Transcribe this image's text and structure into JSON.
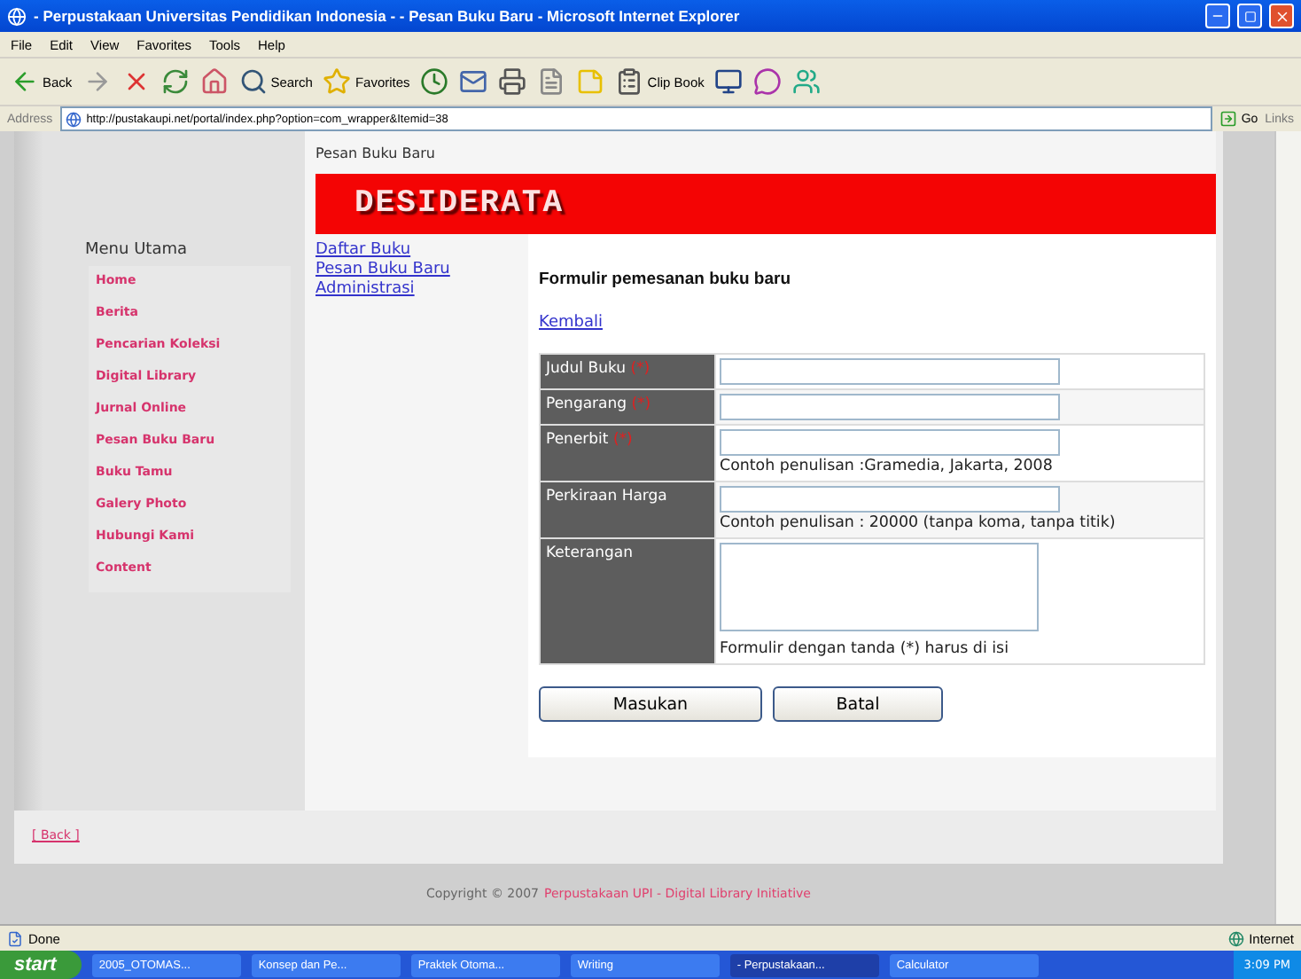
{
  "window": {
    "title": "- Perpustakaan Universitas Pendidikan Indonesia - - Pesan Buku Baru - Microsoft Internet Explorer"
  },
  "menu_bar": [
    "File",
    "Edit",
    "View",
    "Favorites",
    "Tools",
    "Help"
  ],
  "toolbar": [
    {
      "kind": "back",
      "label": "Back"
    },
    {
      "kind": "forward"
    },
    {
      "kind": "stop"
    },
    {
      "kind": "refresh"
    },
    {
      "kind": "home"
    },
    {
      "kind": "search",
      "label": "Search"
    },
    {
      "kind": "favorites",
      "label": "Favorites"
    },
    {
      "kind": "history"
    },
    {
      "kind": "mail"
    },
    {
      "kind": "print"
    },
    {
      "kind": "edit"
    },
    {
      "kind": "note"
    },
    {
      "kind": "clipbook",
      "label": "Clip Book"
    },
    {
      "kind": "screen"
    },
    {
      "kind": "messenger"
    },
    {
      "kind": "people"
    }
  ],
  "address_bar": {
    "label": "Address",
    "url": "http://pustakaupi.net/portal/index.php?option=com_wrapper&Itemid=38",
    "go": "Go",
    "links": "Links"
  },
  "page": {
    "breadcrumb": "Pesan Buku Baru",
    "banner": "DESIDERATA",
    "sidebar": {
      "title": "Menu Utama",
      "items": [
        "Home",
        "Berita",
        "Pencarian Koleksi",
        "Digital Library",
        "Jurnal Online",
        "Pesan Buku Baru",
        "Buku Tamu",
        "Galery Photo",
        "Hubungi Kami",
        "Content"
      ]
    },
    "sub_links": [
      "Daftar Buku",
      "Pesan Buku Baru",
      "Administrasi"
    ],
    "form": {
      "title": "Formulir pemesanan buku baru",
      "back_link": "Kembali",
      "fields": [
        {
          "kind": "input",
          "label": "Judul Buku",
          "marker": "(*)"
        },
        {
          "kind": "input",
          "label": "Pengarang",
          "marker": "(*)"
        },
        {
          "kind": "input",
          "label": "Penerbit",
          "marker": "(*)",
          "hint": "Contoh penulisan :Gramedia, Jakarta, 2008"
        },
        {
          "kind": "input",
          "label": "Perkiraan Harga",
          "hint": "Contoh penulisan : 20000 (tanpa koma, tanpa titik)"
        },
        {
          "kind": "textarea",
          "label": "Keterangan",
          "hint": "Formulir dengan tanda (*) harus di isi"
        }
      ],
      "buttons": [
        "Masukan",
        "Batal"
      ]
    },
    "back": "[ Back ]",
    "footer": {
      "text": "Copyright © 2007",
      "link": "Perpustakaan UPI - Digital Library Initiative"
    }
  },
  "status_bar": {
    "text": "Done",
    "zone": "Internet"
  },
  "taskbar": {
    "start": "start",
    "tasks": [
      {
        "label": "2005_OTOMAS...",
        "selected": false
      },
      {
        "label": "Konsep dan Pe...",
        "selected": false
      },
      {
        "label": "Praktek Otoma...",
        "selected": false
      },
      {
        "label": "Writing",
        "selected": false
      },
      {
        "label": "- Perpustakaan...",
        "selected": true
      },
      {
        "label": "Calculator",
        "selected": false
      }
    ],
    "time": "3:09 PM"
  }
}
